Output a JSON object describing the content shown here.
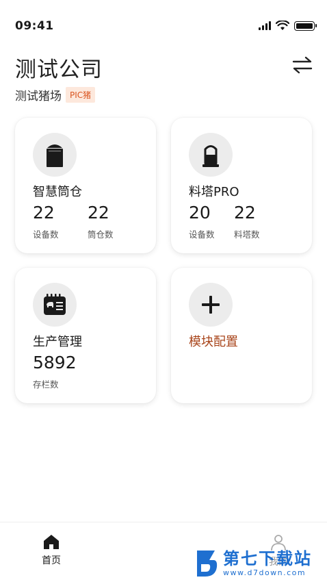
{
  "status_bar": {
    "time": "09:41"
  },
  "header": {
    "company": "测试公司",
    "farm": "测试猪场",
    "farm_tag": "PIC猪"
  },
  "cards": [
    {
      "title": "智慧筒仓",
      "icon": "silo-icon",
      "stats": [
        {
          "value": "22",
          "label": "设备数"
        },
        {
          "value": "22",
          "label": "筒仓数"
        }
      ]
    },
    {
      "title": "料塔PRO",
      "icon": "feed-tower-icon",
      "stats": [
        {
          "value": "20",
          "label": "设备数"
        },
        {
          "value": "22",
          "label": "料塔数"
        }
      ]
    },
    {
      "title": "生产管理",
      "icon": "production-calendar-icon",
      "stats": [
        {
          "value": "5892",
          "label": "存栏数"
        }
      ]
    },
    {
      "title": "模块配置",
      "icon": "plus-icon",
      "accent": "#a8441a"
    }
  ],
  "tabbar": {
    "home_label": "首页",
    "profile_label": "我的"
  },
  "watermark": {
    "title": "第七下载站",
    "url": "www.d7down.com"
  },
  "colors": {
    "accent": "#a8441a",
    "tag_bg": "#fde8dc",
    "tag_text": "#d9531e",
    "watermark": "#1e6fd0"
  }
}
